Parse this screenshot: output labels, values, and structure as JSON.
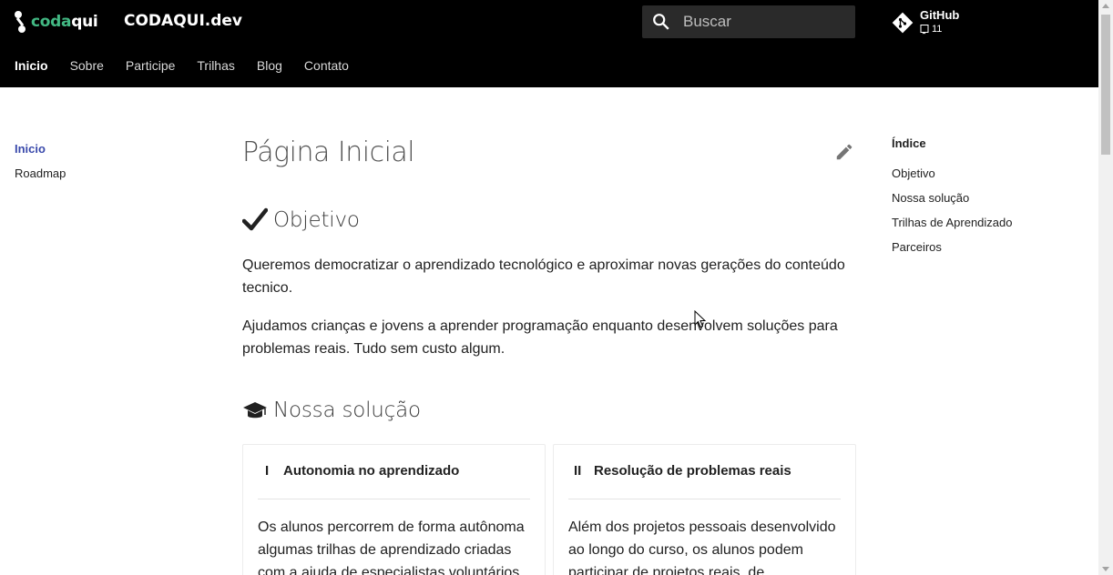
{
  "header": {
    "logo": {
      "part1": "coda",
      "part2": "qui"
    },
    "site_title": "CODAQUI.dev",
    "search": {
      "placeholder": "Buscar"
    },
    "repo": {
      "name": "GitHub",
      "count": "11"
    }
  },
  "tabs": [
    {
      "label": "Inicio",
      "active": true
    },
    {
      "label": "Sobre"
    },
    {
      "label": "Participe"
    },
    {
      "label": "Trilhas"
    },
    {
      "label": "Blog"
    },
    {
      "label": "Contato"
    }
  ],
  "left_nav": [
    {
      "label": "Inicio",
      "active": true
    },
    {
      "label": "Roadmap"
    }
  ],
  "toc": {
    "title": "Índice",
    "items": [
      "Objetivo",
      "Nossa solução",
      "Trilhas de Aprendizado",
      "Parceiros"
    ]
  },
  "content": {
    "title": "Página Inicial",
    "objetivo": {
      "heading": "Objetivo",
      "p1": "Queremos democratizar o aprendizado tecnológico e aproximar novas gerações do conteúdo tecnico.",
      "p2": "Ajudamos crianças e jovens a aprender programação enquanto desenvolvem soluções para problemas reais. Tudo sem custo algum."
    },
    "solucao": {
      "heading": "Nossa solução",
      "cards": [
        {
          "num": "I",
          "title": "Autonomia no aprendizado",
          "body": "Os alunos percorrem de forma autônoma algumas trilhas de aprendizado criadas com a ajuda de especialistas voluntários"
        },
        {
          "num": "II",
          "title": "Resolução de problemas reais",
          "body": "Além dos projetos pessoais desenvolvido ao longo do curso, os alunos podem participar de projetos reais, de"
        }
      ]
    }
  },
  "colors": {
    "header_bg": "#000000",
    "brand_green": "#42b883",
    "nav_active": "#3949ab"
  },
  "icons": [
    "codaqui-logo-icon",
    "search-icon",
    "git-icon",
    "repo-icon",
    "edit-icon",
    "checkmark-icon",
    "graduation-cap-icon"
  ]
}
